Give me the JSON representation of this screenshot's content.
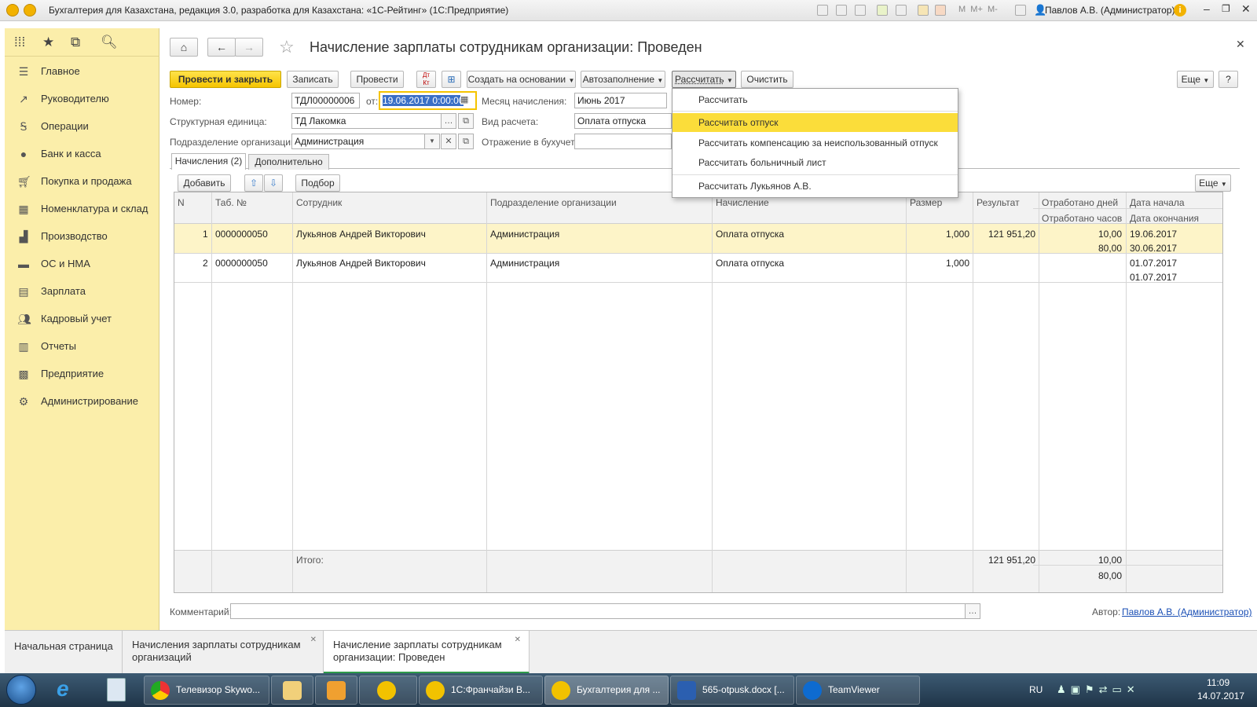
{
  "window": {
    "title": "Бухгалтерия для Казахстана, редакция 3.0, разработка для Казахстана: «1С-Рейтинг» (1С:Предприятие)",
    "user": "Павлов А.В. (Администратор)"
  },
  "sidebar": {
    "items": [
      {
        "label": "Главное",
        "icon": "menu-icon"
      },
      {
        "label": "Руководителю",
        "icon": "chart-trend-icon"
      },
      {
        "label": "Операции",
        "icon": "operations-icon"
      },
      {
        "label": "Банк и касса",
        "icon": "bank-icon"
      },
      {
        "label": "Покупка и продажа",
        "icon": "cart-icon"
      },
      {
        "label": "Номенклатура и склад",
        "icon": "grid-icon"
      },
      {
        "label": "Производство",
        "icon": "factory-icon"
      },
      {
        "label": "ОС и НМА",
        "icon": "truck-icon"
      },
      {
        "label": "Зарплата",
        "icon": "salary-icon"
      },
      {
        "label": "Кадровый учет",
        "icon": "people-icon"
      },
      {
        "label": "Отчеты",
        "icon": "reports-icon"
      },
      {
        "label": "Предприятие",
        "icon": "enterprise-icon"
      },
      {
        "label": "Администрирование",
        "icon": "gear-icon"
      }
    ]
  },
  "document": {
    "title": "Начисление зарплаты сотрудникам организации: Проведен",
    "toolbar": {
      "post_close": "Провести и закрыть",
      "save": "Записать",
      "post": "Провести",
      "create_based": "Создать на основании",
      "autofill": "Автозаполнение",
      "calculate": "Рассчитать",
      "clear": "Очистить",
      "more": "Еще",
      "help": "?"
    },
    "fields": {
      "number_label": "Номер:",
      "number_value": "ТДЛ00000006",
      "date_label": "от:",
      "date_value": "19.06.2017  0:00:00",
      "month_label": "Месяц начисления:",
      "month_value": "Июнь 2017",
      "unit_label": "Структурная единица:",
      "unit_value": "ТД Лакомка",
      "calc_type_label": "Вид расчета:",
      "calc_type_value": "Оплата отпуска",
      "dept_label": "Подразделение организации:",
      "dept_value": "Администрация",
      "reflection_label": "Отражение в бухучете:",
      "reflection_value": ""
    },
    "tabs": [
      "Начисления (2)",
      "Дополнительно"
    ],
    "table_toolbar": {
      "add": "Добавить",
      "pick": "Подбор",
      "more": "Еще"
    },
    "columns": {
      "n": "N",
      "tab": "Таб. №",
      "employee": "Сотрудник",
      "dept": "Подразделение организации",
      "accrual": "Начисление",
      "size": "Размер",
      "result": "Результат",
      "days": "Отработано дней",
      "hours": "Отработано часов",
      "start": "Дата начала",
      "end": "Дата окончания"
    },
    "rows": [
      {
        "n": "1",
        "tab": "0000000050",
        "employee": "Лукьянов Андрей Викторович",
        "dept": "Администрация",
        "accrual": "Оплата отпуска",
        "size": "1,000",
        "result": "121 951,20",
        "days": "10,00",
        "hours": "80,00",
        "start": "19.06.2017",
        "end": "30.06.2017"
      },
      {
        "n": "2",
        "tab": "0000000050",
        "employee": "Лукьянов Андрей Викторович",
        "dept": "Администрация",
        "accrual": "Оплата отпуска",
        "size": "1,000",
        "result": "",
        "days": "",
        "hours": "",
        "start": "01.07.2017",
        "end": "01.07.2017"
      }
    ],
    "totals": {
      "label": "Итого:",
      "result": "121 951,20",
      "days": "10,00",
      "hours": "80,00"
    },
    "comment_label": "Комментарий:",
    "comment_value": "",
    "author_label": "Автор:",
    "author_value": "Павлов А.В. (Администратор)"
  },
  "calc_menu": {
    "items": [
      "Рассчитать",
      "Рассчитать отпуск",
      "Рассчитать компенсацию за неиспользованный отпуск",
      "Рассчитать больничный лист",
      "Рассчитать Лукьянов А.В."
    ],
    "selected_index": 1
  },
  "bottom_tabs": [
    "Начальная страница",
    "Начисления зарплаты сотрудникам организаций",
    "Начисление зарплаты сотрудникам организации: Проведен"
  ],
  "taskbar": {
    "windows": [
      "Телевизор Skywo...",
      "",
      "",
      "",
      "1С:Франчайзи В...",
      "Бухгалтерия для ...",
      "565-otpusk.docx [...",
      "TeamViewer"
    ],
    "lang": "RU",
    "time": "11:09",
    "date": "14.07.2017"
  },
  "colors": {
    "accent": "#f5c400",
    "sidebar": "#fbeeaa",
    "selected_row": "#fdf4c8",
    "menu_highlight": "#fbdd3a"
  }
}
